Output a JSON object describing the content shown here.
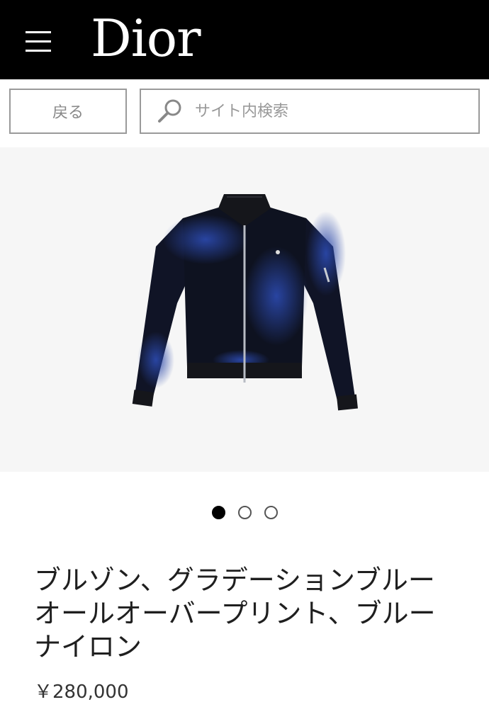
{
  "header": {
    "menu_icon": "hamburger-icon",
    "logo": "Dior",
    "background": "#000000"
  },
  "toolbar": {
    "back_label": "戻る",
    "search_icon": "search-icon",
    "search_placeholder": "サイト内検索"
  },
  "gallery": {
    "image": "jacket-product-image",
    "slides": [
      {
        "active": true
      },
      {
        "active": false
      },
      {
        "active": false
      }
    ]
  },
  "product": {
    "title": "ブルゾン、グラデーションブルー オールオーバープリント、ブルー ナイロン",
    "price": "￥280,000"
  }
}
